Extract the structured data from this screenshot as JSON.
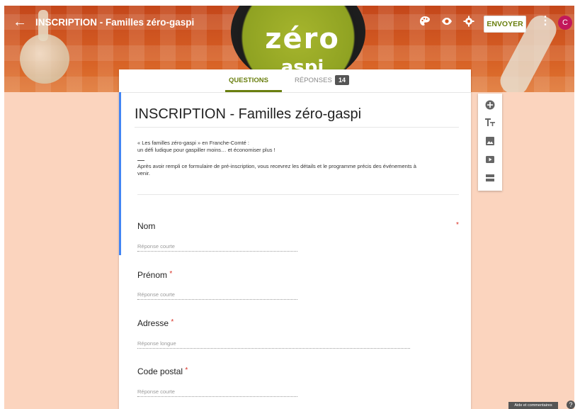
{
  "header": {
    "back_icon": "arrow-left-icon",
    "title": "INSCRIPTION - Familles zéro-gaspi",
    "logo_text_line1": "zéro",
    "logo_text_line2": "aspi",
    "icons": [
      "palette-icon",
      "eye-icon",
      "gear-icon"
    ],
    "send_label": "ENVOYER",
    "more_icon": "kebab-icon",
    "avatar_initial": "C",
    "accent_color": "#6a7f0f"
  },
  "tabs": {
    "questions_label": "QUESTIONS",
    "responses_label": "RÉPONSES",
    "responses_count": "14"
  },
  "form": {
    "title": "INSCRIPTION - Familles zéro-gaspi",
    "description_line1": "« Les familles zéro-gaspi » en Franche-Comté :",
    "description_line2": "un défi ludique pour gaspiller moins… et économiser plus !",
    "description_line3": "Après avoir rempli ce formulaire de pré-inscription, vous recevrez les détails et le programme précis des événements à",
    "description_line4": "venir."
  },
  "questions": [
    {
      "label": "Nom",
      "placeholder": "Réponse courte",
      "required": "*"
    },
    {
      "label": "Prénom",
      "placeholder": "Réponse courte",
      "required": "*"
    },
    {
      "label": "Adresse",
      "placeholder": "Réponse longue",
      "required": "*"
    },
    {
      "label": "Code postal",
      "placeholder": "Réponse courte",
      "required": "*"
    }
  ],
  "side_toolbar": {
    "icons": [
      "add-question-icon",
      "title-text-icon",
      "image-icon",
      "video-icon",
      "section-icon"
    ]
  },
  "footer": {
    "help_label": "Aide et commentaires",
    "help_icon": "question-icon"
  }
}
